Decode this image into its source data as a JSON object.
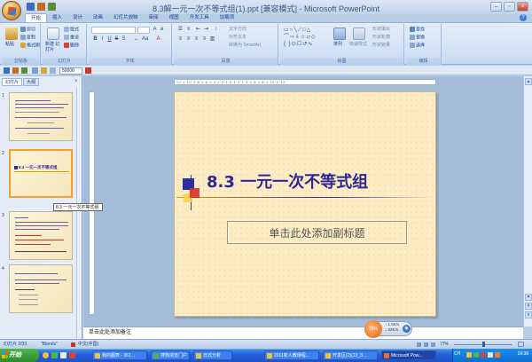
{
  "window": {
    "title": "8.3解一元一次不等式组(1).ppt [兼容模式] - Microsoft PowerPoint",
    "minimize": "–",
    "restore": "▫",
    "close": "×",
    "help": "?"
  },
  "ribbon_tabs": [
    "开始",
    "插入",
    "设计",
    "动画",
    "幻灯片放映",
    "审阅",
    "视图",
    "开发工具",
    "加载项"
  ],
  "clipboard": {
    "paste": "粘贴",
    "cut": "剪切",
    "copy": "复制",
    "format_painter": "格式刷",
    "group": "剪贴板"
  },
  "slides_group": {
    "new_slide": "新建\n幻灯片",
    "layout": "版式",
    "reset": "重设",
    "delete": "删除",
    "group": "幻灯片"
  },
  "font_group": {
    "font_name": "",
    "font_size": "",
    "group": "字体"
  },
  "paragraph_group": {
    "text_direction": "文字方向",
    "align_text": "对齐文本",
    "smartart": "转换为 SmartArt",
    "group": "段落"
  },
  "drawing_group": {
    "arrange": "排列",
    "quick_styles": "快速样式",
    "shape_fill": "形状填充",
    "shape_outline": "形状轮廓",
    "shape_effects": "形状效果",
    "group": "绘图"
  },
  "editing_group": {
    "find": "查找",
    "replace": "替换",
    "select": "选择",
    "group": "编辑"
  },
  "toolbar": {
    "zoom_value": "50000"
  },
  "left_pane": {
    "tabs": [
      "幻灯片",
      "大纲"
    ],
    "close": "×",
    "slide_numbers": [
      "1",
      "2",
      "3",
      "4"
    ],
    "thumb2_title": "8.3 一元一次不等式组",
    "tooltip": "8.3 一元一次不等式组"
  },
  "ruler_text": "·12·1·10·1·8·1·6·1·4·1·2·1·0·1·2·1·4·1·6·1·8·1·10·1·12·",
  "slide": {
    "title": "8.3 一元一次不等式组",
    "subtitle": "单击此处添加副标题"
  },
  "notes_placeholder": "单击此处添加备注",
  "balloon": {
    "percent": "75%",
    "line1": "↑ 1.8K/s",
    "line2": "↓ 22K/s"
  },
  "status": {
    "slide_info": "幻灯片 2/33",
    "theme": "\"Blends\"",
    "language": "中文(中国)",
    "zoom": "77%"
  },
  "taskbar": {
    "start": "开始",
    "tasks": [
      "我的图表 - 361...",
      "搜狗浏览门户",
      "日式分析",
      "2011新人教课程...",
      "开发区(2)(13_3...",
      "Microsoft Pow..."
    ],
    "clock": "19:38",
    "lang": "CH"
  },
  "colors": {
    "accent": "#2e2596",
    "slide_bg": "#fcecc3",
    "ribbon": "#d5e3f5",
    "taskbar": "#245edb"
  }
}
